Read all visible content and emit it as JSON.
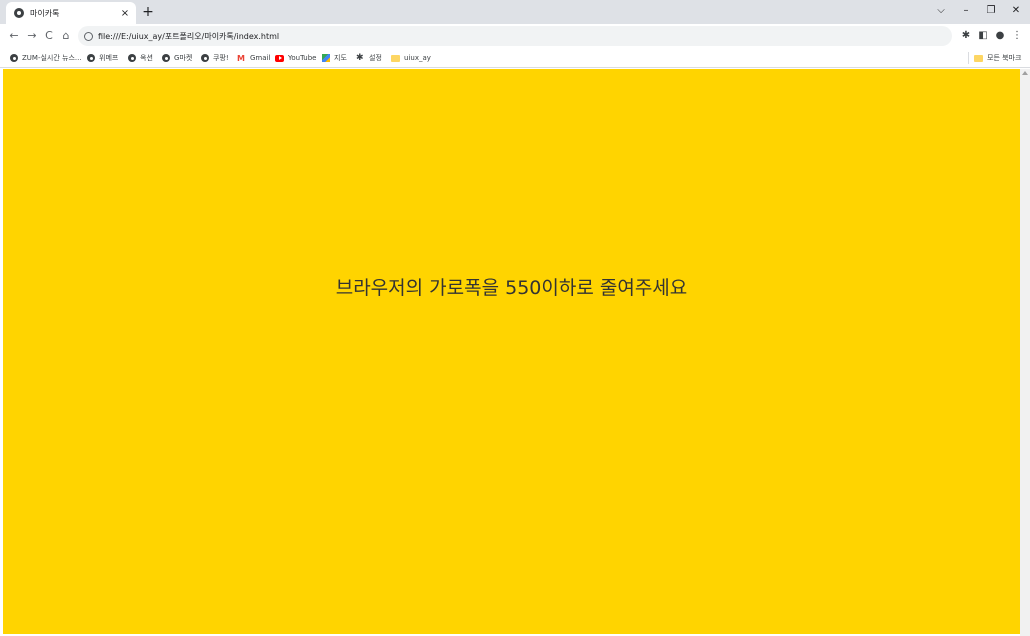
{
  "tab": {
    "title": "마이카톡",
    "close": "×"
  },
  "new_tab": "+",
  "window_controls": {
    "tabsearch": "⌵",
    "minimize": "–",
    "restore": "❐",
    "close": "✕"
  },
  "toolbar": {
    "back": "←",
    "forward": "→",
    "reload": "C",
    "home": "⌂",
    "url": "file:///E:/uiux_ay/포트폴리오/마이카톡/index.html",
    "extensions": "✱",
    "sidepanel": "◧",
    "profile": "●",
    "menu": "⋮"
  },
  "bookmarks": [
    {
      "label": "ZUM-실시간 뉴스...",
      "icon": "globe-icon"
    },
    {
      "label": "위메프",
      "icon": "globe-icon"
    },
    {
      "label": "옥션",
      "icon": "globe-icon"
    },
    {
      "label": "G마켓",
      "icon": "globe-icon"
    },
    {
      "label": "쿠팡!",
      "icon": "globe-icon"
    },
    {
      "label": "Gmail",
      "icon": "gmail-icon"
    },
    {
      "label": "YouTube",
      "icon": "youtube-icon"
    },
    {
      "label": "지도",
      "icon": "maps-icon"
    },
    {
      "label": "설정",
      "icon": "gear-icon"
    },
    {
      "label": "uiux_ay",
      "icon": "folder-icon"
    }
  ],
  "all_bookmarks": "모든 북마크",
  "page": {
    "message": "브라우저의 가로폭을 550이하로 줄여주세요",
    "background": "#ffd400"
  }
}
